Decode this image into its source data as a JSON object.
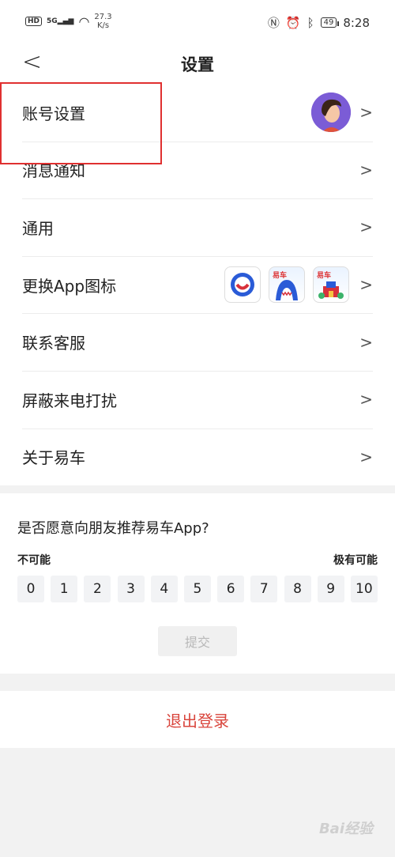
{
  "status_bar": {
    "hd": "HD",
    "signal": "5G",
    "speed_value": "27.3",
    "speed_unit": "K/s",
    "battery": "49",
    "time": "8:28"
  },
  "nav": {
    "back": "<",
    "title": "设置"
  },
  "menu": [
    {
      "label": "账号设置",
      "chevron": ">"
    },
    {
      "label": "消息通知",
      "chevron": ">"
    },
    {
      "label": "通用",
      "chevron": ">"
    },
    {
      "label": "更换App图标",
      "chevron": ">"
    },
    {
      "label": "联系客服",
      "chevron": ">"
    },
    {
      "label": "屏蔽来电打扰",
      "chevron": ">"
    },
    {
      "label": "关于易车",
      "chevron": ">"
    }
  ],
  "app_icons": {
    "tag": "易车"
  },
  "survey": {
    "question": "是否愿意向朋友推荐易车App?",
    "low_label": "不可能",
    "high_label": "极有可能",
    "scores": [
      "0",
      "1",
      "2",
      "3",
      "4",
      "5",
      "6",
      "7",
      "8",
      "9",
      "10"
    ],
    "submit": "提交"
  },
  "logout": "退出登录",
  "watermark": "Bai经验"
}
